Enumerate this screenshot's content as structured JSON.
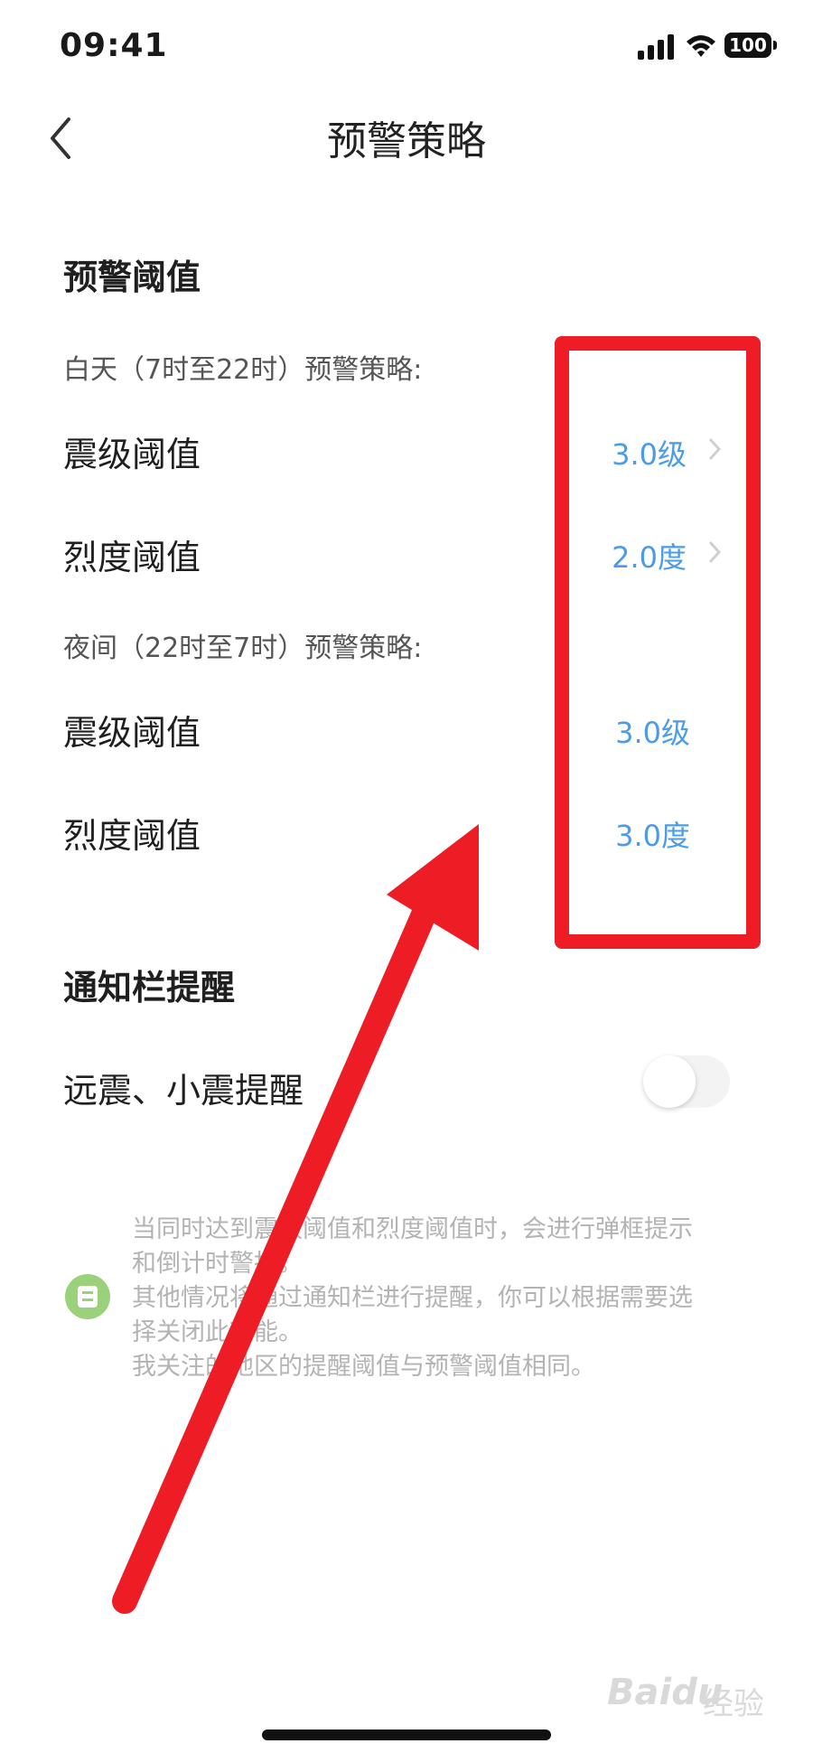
{
  "status_bar": {
    "time": "09:41",
    "battery": "100"
  },
  "header": {
    "title": "预警策略",
    "back_icon": "chevron-left-icon"
  },
  "threshold_section": {
    "heading": "预警阈值",
    "day": {
      "label": "白天（7时至22时）预警策略:",
      "rows": [
        {
          "label": "震级阈值",
          "value": "3.0级"
        },
        {
          "label": "烈度阈值",
          "value": "2.0度"
        }
      ]
    },
    "night": {
      "label": "夜间（22时至7时）预警策略:",
      "rows": [
        {
          "label": "震级阈值",
          "value": "3.0级"
        },
        {
          "label": "烈度阈值",
          "value": "3.0度"
        }
      ]
    }
  },
  "notification_section": {
    "heading": "通知栏提醒",
    "toggle_label": "远震、小震提醒",
    "toggle_on": false
  },
  "tip": {
    "lines": [
      "当同时达到震级阈值和烈度阈值时，会进行弹框提示",
      "和倒计时警报。",
      "其他情况将通过通知栏进行提醒，你可以根据需要选",
      "择关闭此功能。",
      "我关注的地区的提醒阈值与预警阈值相同。"
    ]
  },
  "watermark": {
    "brand": "Baidu",
    "sub": "经验"
  },
  "colors": {
    "value": "#4c9be8",
    "highlight": "#ee1c24",
    "tip_icon": "#9bd17a"
  }
}
